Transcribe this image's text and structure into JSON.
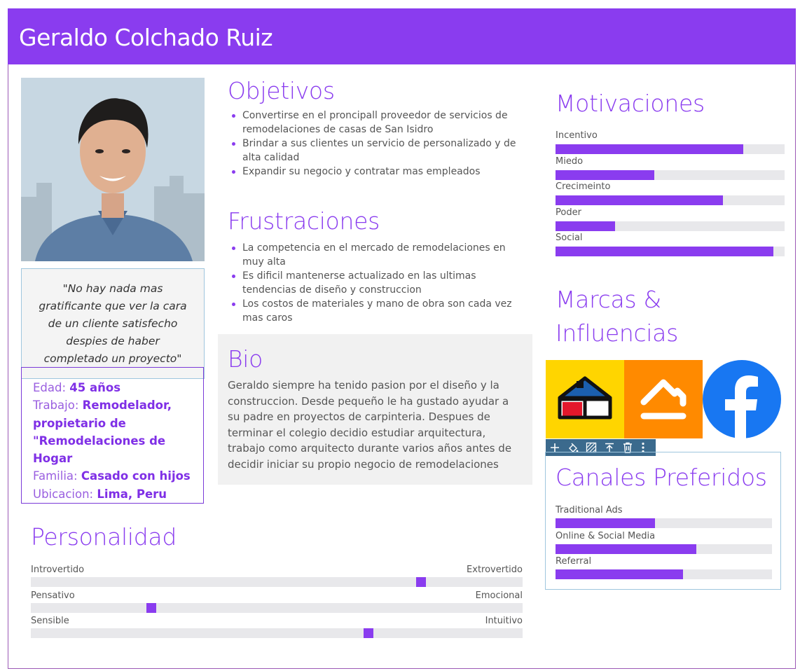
{
  "header": {
    "title": "Geraldo Colchado Ruiz"
  },
  "colors": {
    "accent": "#8a3cef",
    "track": "#e8e8eb"
  },
  "quote": "\"No hay nada mas gratificante que ver la cara de un cliente satisfecho despies de haber completado un proyecto\"",
  "info": {
    "edad_label": "Edad:",
    "edad_value": "45 años",
    "trabajo_label": "Trabajo:",
    "trabajo_value_1": "Remodelador,",
    "trabajo_value_2": "propietario de",
    "trabajo_value_3": "\"Remodelaciones de",
    "trabajo_value_4": "Hogar",
    "familia_label": "Familia:",
    "familia_value": "Casado con hijos",
    "ubicacion_label": "Ubicacion:",
    "ubicacion_value": "Lima, Peru"
  },
  "objetivos": {
    "title": "Objetivos",
    "items": [
      "Convertirse en el proncipall proveedor de servicios de remodelaciones de casas de San Isidro",
      "Brindar a sus clientes un servicio de personalizado y de alta calidad",
      "Expandir su negocio y contratar mas empleados"
    ]
  },
  "frustraciones": {
    "title": "Frustraciones",
    "items": [
      "La competencia en el mercado de remodelaciones en muy alta",
      "Es dificil mantenerse actualizado en las ultimas tendencias de diseño y construccion",
      "Los costos de materiales y mano de obra son cada vez mas caros"
    ]
  },
  "bio": {
    "title": "Bio",
    "text": "Geraldo siempre ha tenido pasion por el diseño y la construccion. Desde pequeño le ha gustado ayudar a su padre en proyectos de carpinteria. Despues de terminar el colegio decidio estudiar arquitectura, trabajo como arquitecto durante varios años antes de decidir iniciar su propio negocio de remodelaciones"
  },
  "motivaciones": {
    "title": "Motivaciones",
    "items": [
      {
        "label": "Incentivo",
        "value": 0.82
      },
      {
        "label": "Miedo",
        "value": 0.43
      },
      {
        "label": "Crecimeinto",
        "value": 0.73
      },
      {
        "label": "Poder",
        "value": 0.26
      },
      {
        "label": "Social",
        "value": 0.95
      }
    ]
  },
  "marcas": {
    "title_1": "Marcas &",
    "title_2": "Influencias",
    "brands": [
      "home-store-logo",
      "sodimac-logo",
      "facebook-logo"
    ]
  },
  "toolbar": {
    "icons": [
      "plus-icon",
      "paint-bucket-icon",
      "pattern-icon",
      "move-up-icon",
      "trash-icon",
      "more-icon"
    ]
  },
  "canales": {
    "title": "Canales Preferidos",
    "items": [
      {
        "label": "Traditional Ads",
        "value": 0.46
      },
      {
        "label": "Online & Social Media",
        "value": 0.65
      },
      {
        "label": "Referral",
        "value": 0.59
      }
    ]
  },
  "personalidad": {
    "title": "Personalidad",
    "items": [
      {
        "left": "Introvertido",
        "right": "Extrovertido",
        "value": 0.8
      },
      {
        "left": "Pensativo",
        "right": "Emocional",
        "value": 0.24
      },
      {
        "left": "Sensible",
        "right": "Intuitivo",
        "value": 0.69
      }
    ]
  }
}
